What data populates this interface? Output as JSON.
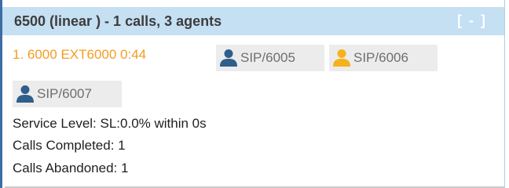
{
  "queue": {
    "title": "6500 (linear ) - 1 calls, 3 agents",
    "collapse_label": "[ - ]"
  },
  "call": {
    "text": "1. 6000 EXT6000 0:44"
  },
  "agents": [
    {
      "label": "SIP/6005",
      "icon": "user-icon",
      "icon_color": "#2e5e8c"
    },
    {
      "label": "SIP/6006",
      "icon": "user-icon",
      "icon_color": "#f6b21b"
    },
    {
      "label": "SIP/6007",
      "icon": "user-icon",
      "icon_color": "#2e5e8c"
    }
  ],
  "stats": {
    "service_level": "Service Level: SL:0.0% within 0s",
    "calls_completed": "Calls Completed: 1",
    "calls_abandoned": "Calls Abandoned: 1"
  },
  "colors": {
    "header_bg": "#c5dff3",
    "accent_border": "#3c6ea3",
    "call_text": "#f39c1f"
  }
}
